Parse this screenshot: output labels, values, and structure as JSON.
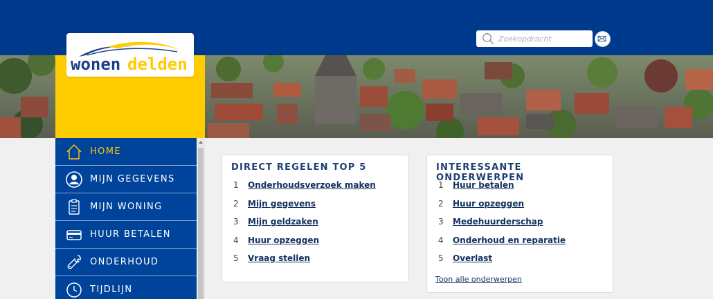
{
  "header": {
    "search": {
      "placeholder": "Zoekopdracht",
      "value": ""
    },
    "mail_icon": "envelope-icon",
    "search_icon": "magnifier-icon"
  },
  "logo": {
    "part1": "wonen",
    "part2": "delden"
  },
  "colors": {
    "primary": "#003a8c",
    "nav": "#00439b",
    "accent": "#ffcc00",
    "link": "#12305f"
  },
  "sidebar": {
    "items": [
      {
        "label": "HOME",
        "icon": "house-icon",
        "active": true
      },
      {
        "label": "MIJN GEGEVENS",
        "icon": "user-icon"
      },
      {
        "label": "MIJN WONING",
        "icon": "clipboard-icon"
      },
      {
        "label": "HUUR BETALEN",
        "icon": "credit-card-icon"
      },
      {
        "label": "ONDERHOUD",
        "icon": "wrench-icon"
      },
      {
        "label": "TIJDLIJN",
        "icon": "clock-icon"
      }
    ]
  },
  "direct_regelen": {
    "title": "DIRECT REGELEN TOP 5",
    "items": [
      {
        "num": "1",
        "label": "Onderhoudsverzoek maken"
      },
      {
        "num": "2",
        "label": "Mijn gegevens"
      },
      {
        "num": "3",
        "label": "Mijn geldzaken"
      },
      {
        "num": "4",
        "label": "Huur opzeggen"
      },
      {
        "num": "5",
        "label": "Vraag stellen"
      }
    ]
  },
  "onderwerpen": {
    "title": "INTERESSANTE ONDERWERPEN",
    "items": [
      {
        "num": "1",
        "label": "Huur betalen"
      },
      {
        "num": "2",
        "label": "Huur opzeggen"
      },
      {
        "num": "3",
        "label": "Medehuurderschap"
      },
      {
        "num": "4",
        "label": "Onderhoud en reparatie"
      },
      {
        "num": "5",
        "label": "Overlast"
      }
    ],
    "all_link": "Toon alle onderwerpen"
  }
}
